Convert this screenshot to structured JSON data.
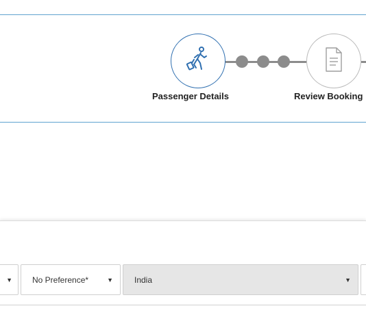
{
  "stepper": {
    "steps": [
      {
        "label": "Passenger Details",
        "icon": "traveler-luggage-icon",
        "state": "active"
      },
      {
        "label": "Review Booking",
        "icon": "document-icon",
        "state": "inactive"
      }
    ]
  },
  "form": {
    "select_prev": {
      "value": ""
    },
    "seat_preference": {
      "value": "No Preference*"
    },
    "nationality": {
      "value": "India"
    }
  },
  "colors": {
    "active_border": "#2f6fb0",
    "band_border": "#5fa3cf",
    "connector": "#8c8c8c",
    "disabled_field": "#e6e6e6"
  }
}
